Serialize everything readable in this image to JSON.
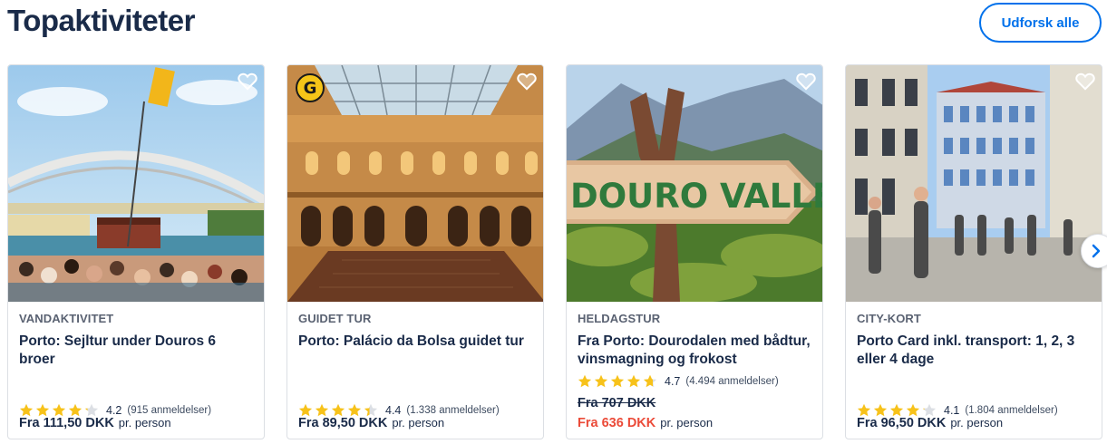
{
  "header": {
    "title": "Topaktiviteter",
    "explore_label": "Udforsk alle"
  },
  "colors": {
    "brand_blue": "#0071eb",
    "text_dark": "#1a2b49",
    "star_yellow": "#f7c21a",
    "sale_red": "#eb4b39"
  },
  "cards": [
    {
      "category": "VANDAKTIVITET",
      "title": "Porto: Sejltur under Douros 6 broer",
      "rating": "4.2",
      "rating_value": 4.2,
      "reviews": "(915 anmeldelser)",
      "price": "Fra 111,50 DKK",
      "per": "pr. person",
      "image_icon": "boat-bridge-photo"
    },
    {
      "category": "GUIDET TUR",
      "title": "Porto: Palácio da Bolsa guidet tur",
      "rating": "4.4",
      "rating_value": 4.4,
      "reviews": "(1.338 anmeldelser)",
      "price": "Fra 89,50 DKK",
      "per": "pr. person",
      "badge": "G",
      "image_icon": "palace-hall-photo"
    },
    {
      "category": "HELDAGSTUR",
      "title": "Fra Porto: Dourodalen med bådtur, vinsmagning og frokost",
      "rating": "4.7",
      "rating_value": 4.7,
      "reviews": "(4.494 anmeldelser)",
      "old_price": "Fra 707 DKK",
      "price": "Fra 636 DKK",
      "per": "pr. person",
      "sign_text": "DOURO VALLEY",
      "image_icon": "wooden-sign-photo"
    },
    {
      "category": "CITY-KORT",
      "title": "Porto Card inkl. transport: 1, 2, 3 eller 4 dage",
      "rating": "4.1",
      "rating_value": 4.1,
      "reviews": "(1.804 anmeldelser)",
      "price": "Fra 96,50 DKK",
      "per": "pr. person",
      "image_icon": "city-street-photo"
    }
  ]
}
